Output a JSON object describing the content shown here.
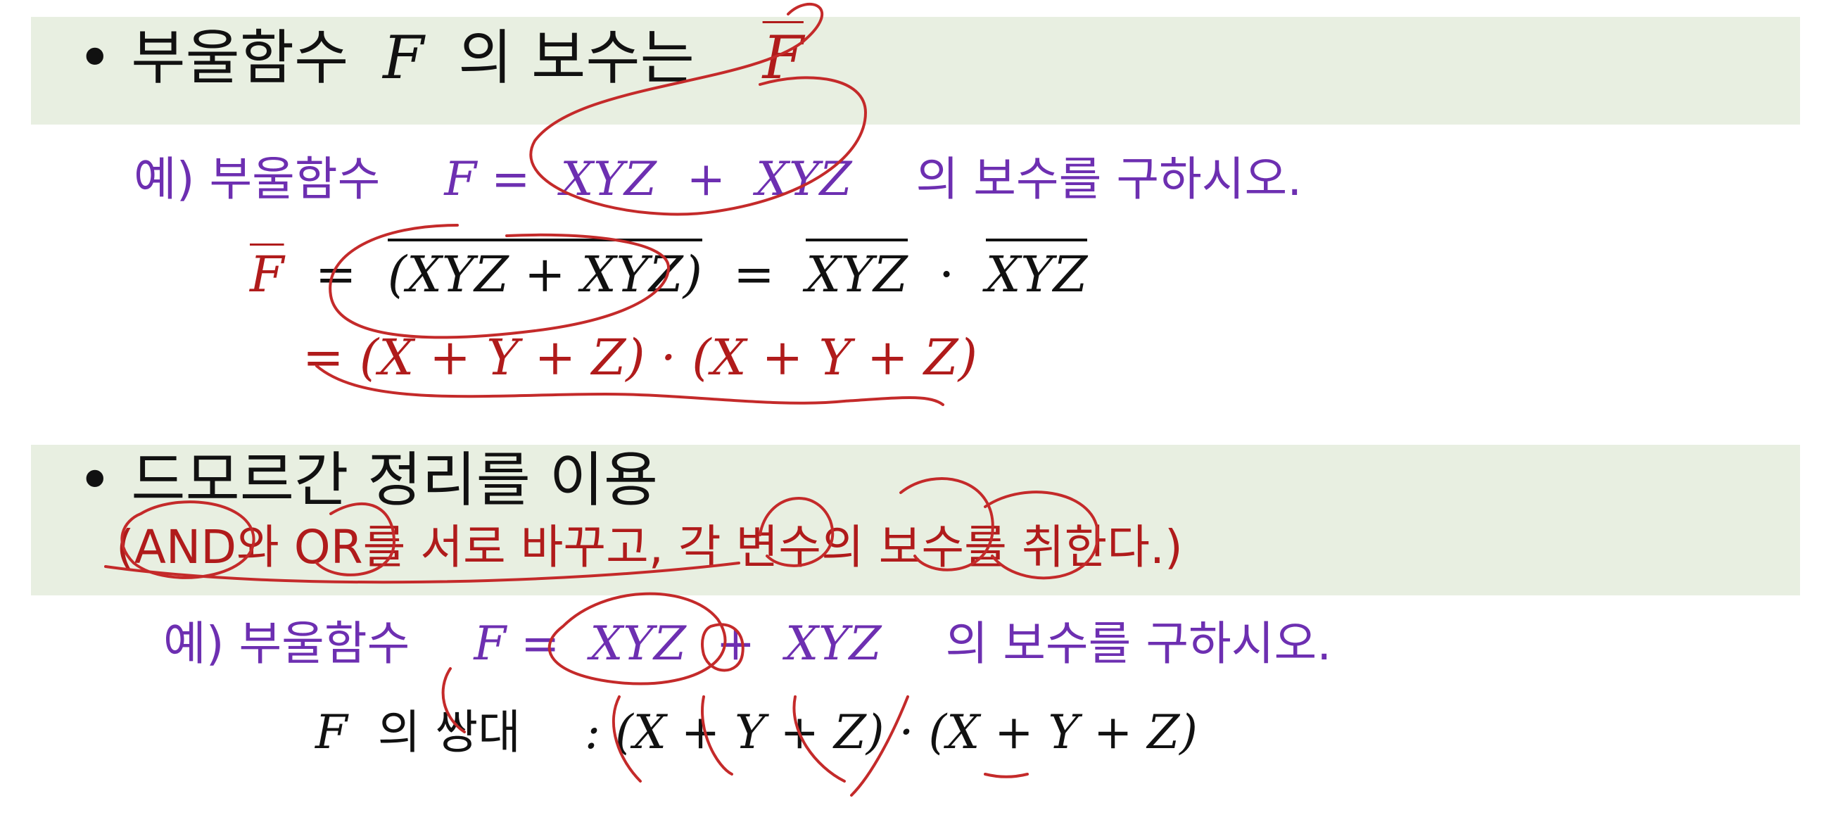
{
  "section1": {
    "bullet": "•",
    "heading_text": "부울함수",
    "heading_var": "F",
    "heading_tail": "의 보수는",
    "heading_complement": "F",
    "example": {
      "prefix": "예) 부울함수",
      "expr_lhs": "F =",
      "expr_t1": "XYZ",
      "expr_plus": "+",
      "expr_t2": "XYZ",
      "suffix": "의 보수를 구하시오."
    },
    "derivation": {
      "lhs": "F",
      "eq1": "=",
      "paren_expr": "(XYZ + XYZ)",
      "eq2": "=",
      "prod_t1": "XYZ",
      "dot": "·",
      "prod_t2": "XYZ",
      "line2": "= (X + Y + Z) · (X + Y + Z)"
    }
  },
  "section2": {
    "bullet": "•",
    "heading": "드모르간 정리를 이용",
    "note": "(AND와 OR를 서로 바꾸고, 각 변수의 보수를 취한다.)",
    "example": {
      "prefix": "예) 부울함수",
      "expr_lhs": "F =",
      "expr_t1": "XYZ",
      "expr_plus": "+",
      "expr_t2": "XYZ",
      "suffix": "의 보수를 구하시오."
    },
    "dual": {
      "var": "F",
      "label": "의 쌍대",
      "expr": ": (X + Y + Z) · (X + Y + Z)"
    }
  },
  "colors": {
    "band": "#e8efe1",
    "heading": "#111111",
    "example": "#6d2fb1",
    "emphasis": "#b01b1b",
    "ink": "#c42a2a"
  }
}
